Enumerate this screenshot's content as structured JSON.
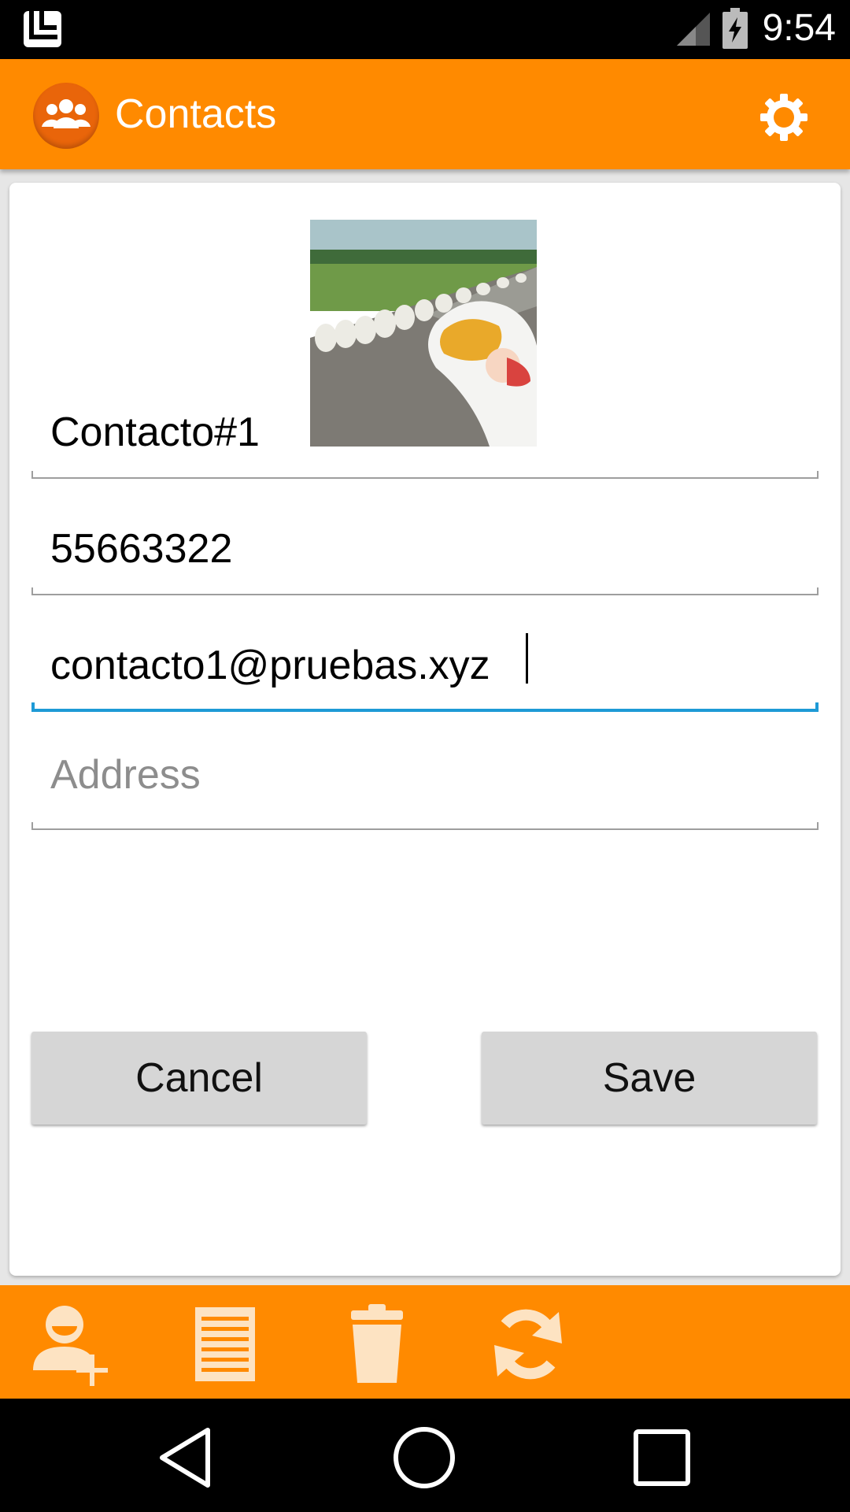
{
  "status_bar": {
    "time": "9:54",
    "icons": [
      "launcher-icon",
      "signal-icon",
      "battery-charging-icon"
    ]
  },
  "app_bar": {
    "title": "Contacts",
    "logo_icon": "contacts-group-icon",
    "settings_icon": "gear-icon"
  },
  "form": {
    "photo_icon": "contact-photo",
    "name": {
      "value": "Contacto#1",
      "placeholder": ""
    },
    "phone": {
      "value": "55663322",
      "placeholder": ""
    },
    "email": {
      "value": "contacto1@pruebas.xyz",
      "placeholder": ""
    },
    "address": {
      "value": "",
      "placeholder": "Address"
    },
    "cancel_label": "Cancel",
    "save_label": "Save"
  },
  "toolbar": {
    "items": [
      "add-contact-icon",
      "list-icon",
      "trash-icon",
      "sync-icon"
    ]
  },
  "navigation": {
    "items": [
      "back-icon",
      "home-icon",
      "recents-icon"
    ]
  },
  "colors": {
    "primary": "#ff8a00",
    "logo_bg": "#e9650a",
    "focus": "#1e9ad6",
    "button_bg": "#d6d6d6"
  }
}
